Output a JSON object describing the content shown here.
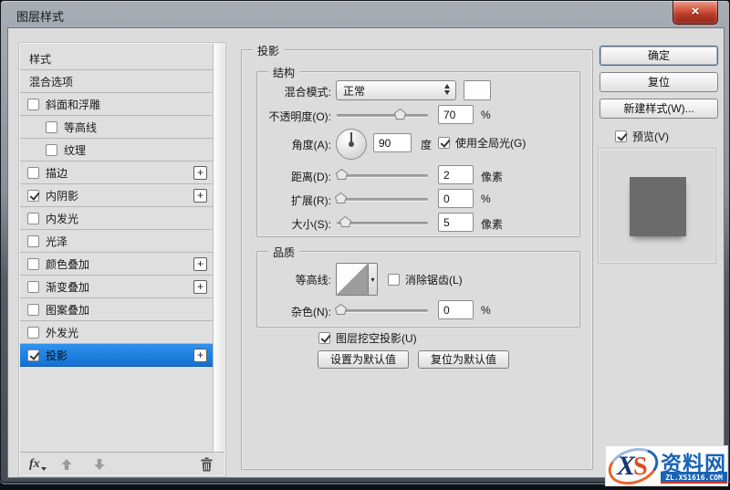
{
  "window": {
    "title": "图层样式",
    "close_glyph": "×"
  },
  "icons": {
    "plus": "+",
    "dropdown_arrow": "▾"
  },
  "sidebar": {
    "items": [
      {
        "label": "样式",
        "checkbox": false,
        "checked": false,
        "indent": false,
        "plus": false,
        "selected": false
      },
      {
        "label": "混合选项",
        "checkbox": false,
        "checked": false,
        "indent": false,
        "plus": false,
        "selected": false
      },
      {
        "label": "斜面和浮雕",
        "checkbox": true,
        "checked": false,
        "indent": false,
        "plus": false,
        "selected": false
      },
      {
        "label": "等高线",
        "checkbox": true,
        "checked": false,
        "indent": true,
        "plus": false,
        "selected": false
      },
      {
        "label": "纹理",
        "checkbox": true,
        "checked": false,
        "indent": true,
        "plus": false,
        "selected": false
      },
      {
        "label": "描边",
        "checkbox": true,
        "checked": false,
        "indent": false,
        "plus": true,
        "selected": false
      },
      {
        "label": "内阴影",
        "checkbox": true,
        "checked": true,
        "indent": false,
        "plus": true,
        "selected": false
      },
      {
        "label": "内发光",
        "checkbox": true,
        "checked": false,
        "indent": false,
        "plus": false,
        "selected": false
      },
      {
        "label": "光泽",
        "checkbox": true,
        "checked": false,
        "indent": false,
        "plus": false,
        "selected": false
      },
      {
        "label": "颜色叠加",
        "checkbox": true,
        "checked": false,
        "indent": false,
        "plus": true,
        "selected": false
      },
      {
        "label": "渐变叠加",
        "checkbox": true,
        "checked": false,
        "indent": false,
        "plus": true,
        "selected": false
      },
      {
        "label": "图案叠加",
        "checkbox": true,
        "checked": false,
        "indent": false,
        "plus": false,
        "selected": false
      },
      {
        "label": "外发光",
        "checkbox": true,
        "checked": false,
        "indent": false,
        "plus": false,
        "selected": false
      },
      {
        "label": "投影",
        "checkbox": true,
        "checked": true,
        "indent": false,
        "plus": true,
        "selected": true
      }
    ],
    "footer": {
      "fx_label": "fx"
    }
  },
  "panel": {
    "title": "投影",
    "structure": {
      "legend": "结构",
      "blend_mode_label": "混合模式:",
      "blend_mode_value": "正常",
      "opacity_label": "不透明度(O):",
      "opacity_value": "70",
      "opacity_unit": "%",
      "opacity_percent": 70,
      "angle_label": "角度(A):",
      "angle_value": "90",
      "angle_unit": "度",
      "global_light_label": "使用全局光(G)",
      "global_light_checked": true,
      "distance_label": "距离(D):",
      "distance_value": "2",
      "distance_unit": "像素",
      "distance_percent": 3,
      "spread_label": "扩展(R):",
      "spread_value": "0",
      "spread_unit": "%",
      "spread_percent": 0,
      "size_label": "大小(S):",
      "size_value": "5",
      "size_unit": "像素",
      "size_percent": 8
    },
    "quality": {
      "legend": "品质",
      "contour_label": "等高线:",
      "antialias_label": "消除锯齿(L)",
      "antialias_checked": false,
      "noise_label": "杂色(N):",
      "noise_value": "0",
      "noise_unit": "%",
      "noise_percent": 0
    },
    "knockout_label": "图层挖空投影(U)",
    "knockout_checked": true,
    "make_default_label": "设置为默认值",
    "reset_default_label": "复位为默认值"
  },
  "actions": {
    "ok": "确定",
    "reset": "复位",
    "new_style": "新建样式(W)...",
    "preview_label": "预览(V)",
    "preview_checked": true
  },
  "colors": {
    "selection_blue": "#1f87e5",
    "preview_square": "#6b6b6b",
    "close_red": "#c4473a"
  },
  "watermark": {
    "x": "X",
    "s": "S",
    "name": "资料网",
    "url": "ZL.XS1616.COM"
  }
}
